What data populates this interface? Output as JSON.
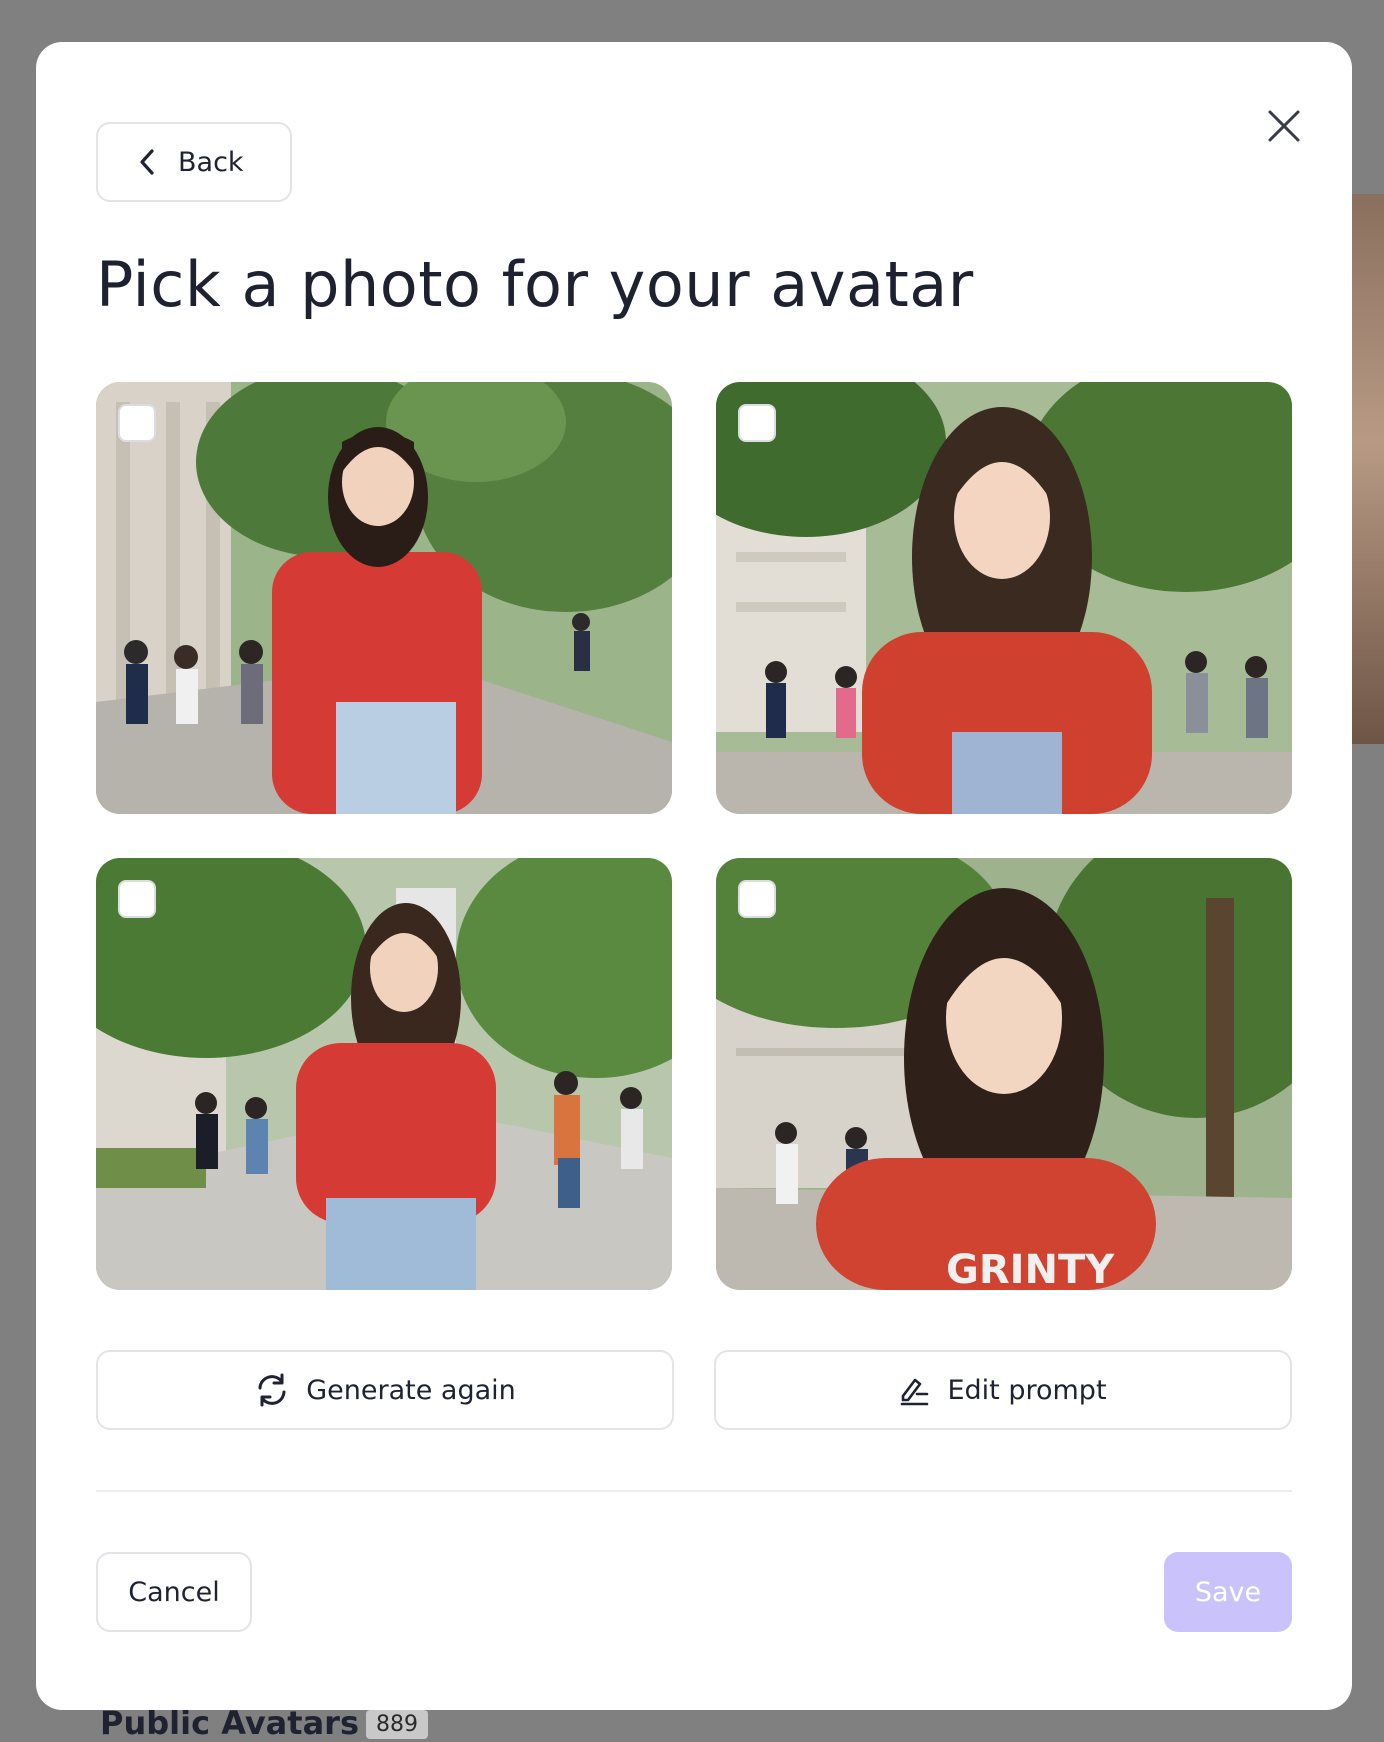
{
  "background": {
    "section_title": "Public Avatars",
    "section_count": "889"
  },
  "modal": {
    "back_label": "Back",
    "title": "Pick a photo for your avatar",
    "photos": [
      {
        "selected": false
      },
      {
        "selected": false
      },
      {
        "selected": false
      },
      {
        "selected": false
      }
    ],
    "generate_again_label": "Generate again",
    "edit_prompt_label": "Edit prompt",
    "cancel_label": "Cancel",
    "save_label": "Save"
  },
  "icons": {
    "close": "close-icon",
    "back": "chevron-left-icon",
    "generate": "refresh-icon",
    "edit": "edit-prompt-icon"
  },
  "colors": {
    "save_disabled": "#c9c2fb",
    "backdrop": "#808080",
    "sweater": "#d63a34"
  }
}
